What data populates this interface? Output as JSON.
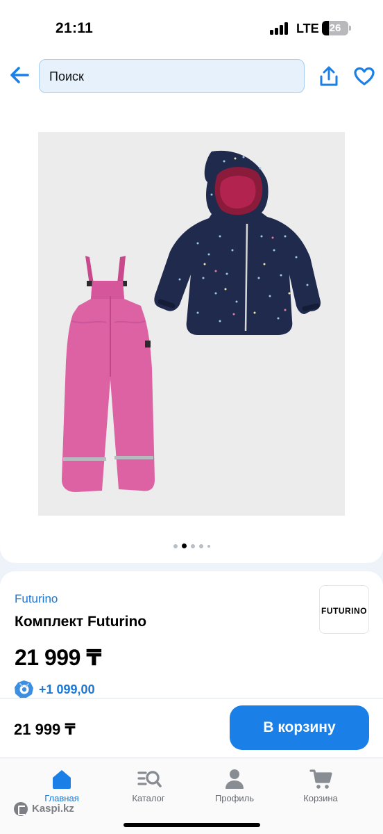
{
  "status_bar": {
    "time": "21:11",
    "network": "LTE",
    "battery": "26"
  },
  "top_nav": {
    "back_icon": "arrow-left-icon",
    "search_placeholder": "Поиск",
    "share_icon": "share-icon",
    "favorite_icon": "heart-icon"
  },
  "gallery": {
    "image_count": 5,
    "active_index": 1
  },
  "product": {
    "brand": "Futurino",
    "brand_logo_text": "FUTURINO",
    "title": "Комплект Futurino",
    "price": "21 999 ₸",
    "bonus": "+1 099,00"
  },
  "purchase_bar": {
    "price": "21 999 ₸",
    "add_to_cart": "В корзину"
  },
  "tab_bar": {
    "tabs": [
      {
        "label": "Главная",
        "icon": "home-icon",
        "active": true
      },
      {
        "label": "Каталог",
        "icon": "catalog-icon",
        "active": false
      },
      {
        "label": "Профиль",
        "icon": "profile-icon",
        "active": false
      },
      {
        "label": "Корзина",
        "icon": "cart-icon",
        "active": false
      }
    ],
    "brand": "Kaspi.kz"
  },
  "colors": {
    "accent": "#1a7fe6",
    "link": "#1c76d2",
    "jacket": "#1f2a4d",
    "overalls": "#dd62a4"
  }
}
